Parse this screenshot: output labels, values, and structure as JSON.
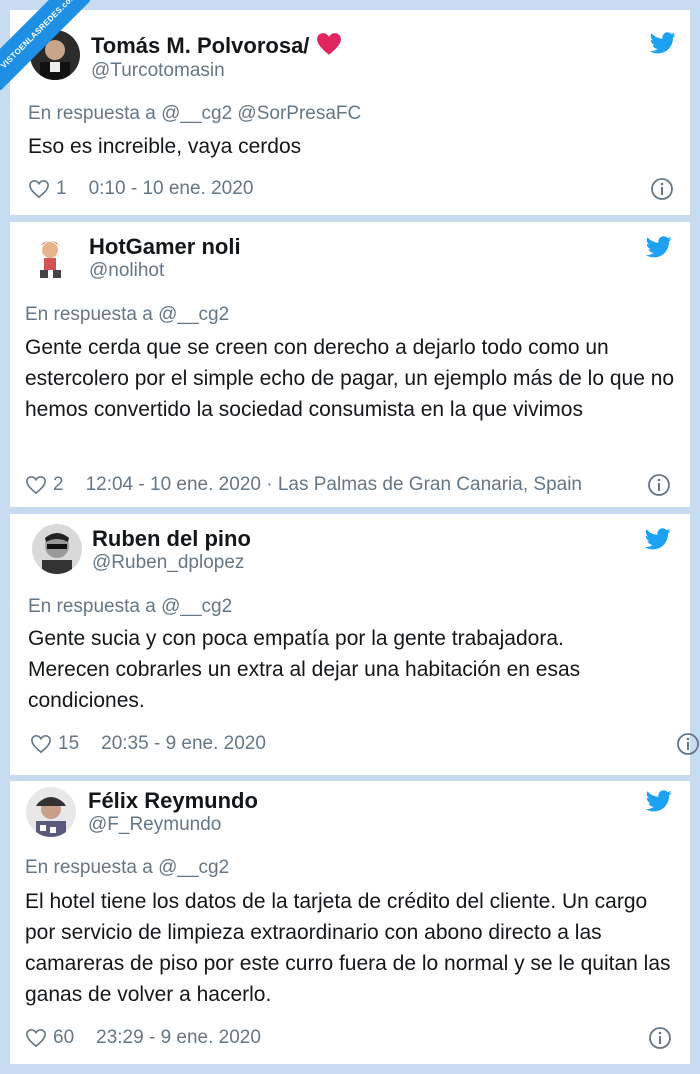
{
  "watermark": {
    "text": "VISTOENLASREDES.com"
  },
  "tweets": [
    {
      "name": "Tomás M. Polvorosa/",
      "handle": "@Turcotomasin",
      "reply": "En respuesta a @__cg2 @SorPresaFC",
      "text": "Eso es increible, vaya cerdos",
      "likes": "1",
      "timestamp": "0:10 - 10 ene. 2020",
      "avatar_icon": "profile-avatar"
    },
    {
      "name": "HotGamer noli",
      "handle": "@nolihot",
      "reply": "En respuesta a @__cg2",
      "text": "Gente cerda que se creen con derecho a dejarlo todo como un estercolero por el simple echo de pagar, un ejemplo más de lo que no hemos convertido la sociedad consumista en la que vivimos",
      "likes": "2",
      "timestamp": "12:04 - 10 ene. 2020 · Las Palmas de Gran Canaria, Spain",
      "avatar_icon": "cartoon-avatar"
    },
    {
      "name": "Ruben del pino",
      "handle": "@Ruben_dplopez",
      "reply": "En respuesta a @__cg2",
      "text": "Gente sucia y con poca empatía por la gente trabajadora. Merecen cobrarles un extra al dejar una habitación en esas condiciones.",
      "likes": "15",
      "timestamp": "20:35 - 9 ene. 2020",
      "avatar_icon": "profile-avatar"
    },
    {
      "name": "Félix Reymundo",
      "handle": "@F_Reymundo",
      "reply": "En respuesta a @__cg2",
      "text": "El hotel tiene los datos de la tarjeta de crédito del cliente. Un cargo por servicio de limpieza extraordinario con abono directo a las camareras de piso por este curro fuera de lo normal y se le quitan las ganas de volver a hacerlo.",
      "likes": "60",
      "timestamp": "23:29 - 9 ene. 2020",
      "avatar_icon": "profile-avatar"
    }
  ],
  "colors": {
    "twitter_blue": "#1da1f2",
    "muted": "#657786",
    "text": "#14171a",
    "heart_emoji": "#e0245e"
  }
}
